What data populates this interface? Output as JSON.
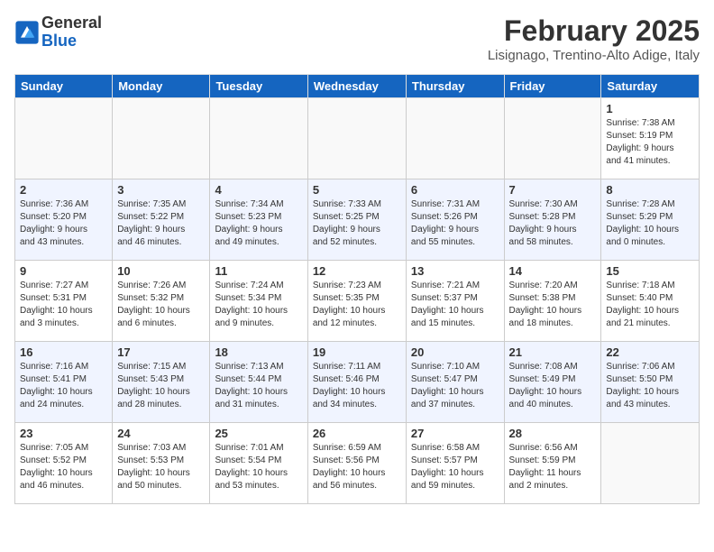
{
  "header": {
    "logo": {
      "general": "General",
      "blue": "Blue"
    },
    "title": "February 2025",
    "location": "Lisignago, Trentino-Alto Adige, Italy"
  },
  "weekdays": [
    "Sunday",
    "Monday",
    "Tuesday",
    "Wednesday",
    "Thursday",
    "Friday",
    "Saturday"
  ],
  "weeks": [
    [
      {
        "day": "",
        "info": ""
      },
      {
        "day": "",
        "info": ""
      },
      {
        "day": "",
        "info": ""
      },
      {
        "day": "",
        "info": ""
      },
      {
        "day": "",
        "info": ""
      },
      {
        "day": "",
        "info": ""
      },
      {
        "day": "1",
        "info": "Sunrise: 7:38 AM\nSunset: 5:19 PM\nDaylight: 9 hours\nand 41 minutes."
      }
    ],
    [
      {
        "day": "2",
        "info": "Sunrise: 7:36 AM\nSunset: 5:20 PM\nDaylight: 9 hours\nand 43 minutes."
      },
      {
        "day": "3",
        "info": "Sunrise: 7:35 AM\nSunset: 5:22 PM\nDaylight: 9 hours\nand 46 minutes."
      },
      {
        "day": "4",
        "info": "Sunrise: 7:34 AM\nSunset: 5:23 PM\nDaylight: 9 hours\nand 49 minutes."
      },
      {
        "day": "5",
        "info": "Sunrise: 7:33 AM\nSunset: 5:25 PM\nDaylight: 9 hours\nand 52 minutes."
      },
      {
        "day": "6",
        "info": "Sunrise: 7:31 AM\nSunset: 5:26 PM\nDaylight: 9 hours\nand 55 minutes."
      },
      {
        "day": "7",
        "info": "Sunrise: 7:30 AM\nSunset: 5:28 PM\nDaylight: 9 hours\nand 58 minutes."
      },
      {
        "day": "8",
        "info": "Sunrise: 7:28 AM\nSunset: 5:29 PM\nDaylight: 10 hours\nand 0 minutes."
      }
    ],
    [
      {
        "day": "9",
        "info": "Sunrise: 7:27 AM\nSunset: 5:31 PM\nDaylight: 10 hours\nand 3 minutes."
      },
      {
        "day": "10",
        "info": "Sunrise: 7:26 AM\nSunset: 5:32 PM\nDaylight: 10 hours\nand 6 minutes."
      },
      {
        "day": "11",
        "info": "Sunrise: 7:24 AM\nSunset: 5:34 PM\nDaylight: 10 hours\nand 9 minutes."
      },
      {
        "day": "12",
        "info": "Sunrise: 7:23 AM\nSunset: 5:35 PM\nDaylight: 10 hours\nand 12 minutes."
      },
      {
        "day": "13",
        "info": "Sunrise: 7:21 AM\nSunset: 5:37 PM\nDaylight: 10 hours\nand 15 minutes."
      },
      {
        "day": "14",
        "info": "Sunrise: 7:20 AM\nSunset: 5:38 PM\nDaylight: 10 hours\nand 18 minutes."
      },
      {
        "day": "15",
        "info": "Sunrise: 7:18 AM\nSunset: 5:40 PM\nDaylight: 10 hours\nand 21 minutes."
      }
    ],
    [
      {
        "day": "16",
        "info": "Sunrise: 7:16 AM\nSunset: 5:41 PM\nDaylight: 10 hours\nand 24 minutes."
      },
      {
        "day": "17",
        "info": "Sunrise: 7:15 AM\nSunset: 5:43 PM\nDaylight: 10 hours\nand 28 minutes."
      },
      {
        "day": "18",
        "info": "Sunrise: 7:13 AM\nSunset: 5:44 PM\nDaylight: 10 hours\nand 31 minutes."
      },
      {
        "day": "19",
        "info": "Sunrise: 7:11 AM\nSunset: 5:46 PM\nDaylight: 10 hours\nand 34 minutes."
      },
      {
        "day": "20",
        "info": "Sunrise: 7:10 AM\nSunset: 5:47 PM\nDaylight: 10 hours\nand 37 minutes."
      },
      {
        "day": "21",
        "info": "Sunrise: 7:08 AM\nSunset: 5:49 PM\nDaylight: 10 hours\nand 40 minutes."
      },
      {
        "day": "22",
        "info": "Sunrise: 7:06 AM\nSunset: 5:50 PM\nDaylight: 10 hours\nand 43 minutes."
      }
    ],
    [
      {
        "day": "23",
        "info": "Sunrise: 7:05 AM\nSunset: 5:52 PM\nDaylight: 10 hours\nand 46 minutes."
      },
      {
        "day": "24",
        "info": "Sunrise: 7:03 AM\nSunset: 5:53 PM\nDaylight: 10 hours\nand 50 minutes."
      },
      {
        "day": "25",
        "info": "Sunrise: 7:01 AM\nSunset: 5:54 PM\nDaylight: 10 hours\nand 53 minutes."
      },
      {
        "day": "26",
        "info": "Sunrise: 6:59 AM\nSunset: 5:56 PM\nDaylight: 10 hours\nand 56 minutes."
      },
      {
        "day": "27",
        "info": "Sunrise: 6:58 AM\nSunset: 5:57 PM\nDaylight: 10 hours\nand 59 minutes."
      },
      {
        "day": "28",
        "info": "Sunrise: 6:56 AM\nSunset: 5:59 PM\nDaylight: 11 hours\nand 2 minutes."
      },
      {
        "day": "",
        "info": ""
      }
    ]
  ]
}
